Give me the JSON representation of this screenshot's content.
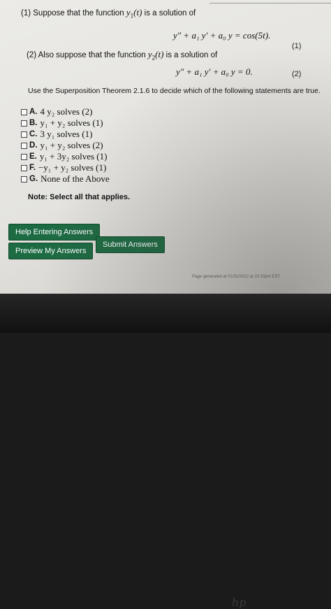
{
  "problem": {
    "part1_prefix": "(1) Suppose that the function ",
    "part1_func": "y",
    "part1_sub": "1",
    "part1_arg": "(t)",
    "part1_suffix": " is a solution of",
    "eq1": "y″ + a₁ y′ + a₀ y = cos(5t).",
    "eq1_num": "(1)",
    "part2_prefix": "(2) Also suppose that the function ",
    "part2_func": "y",
    "part2_sub": "2",
    "part2_arg": "(t)",
    "part2_suffix": " is a solution of",
    "eq2": "y″ + a₁ y′ + a₀ y = 0.",
    "eq2_num": "(2)",
    "instruction": "Use the Superposition Theorem 2.1.6 to decide which of the following statements are true."
  },
  "options": [
    {
      "letter": "A.",
      "text": "4 y₂  solves (2)",
      "checked": false
    },
    {
      "letter": "B.",
      "text": "y₁ + y₂  solves (1)",
      "checked": false
    },
    {
      "letter": "C.",
      "text": "3 y₁  solves (1)",
      "checked": false
    },
    {
      "letter": "D.",
      "text": "y₁ + y₂  solves (2)",
      "checked": false
    },
    {
      "letter": "E.",
      "text": "y₁ + 3y₂  solves (1)",
      "checked": false
    },
    {
      "letter": "F.",
      "text": "−y₁ + y₂  solves (1)",
      "checked": false
    },
    {
      "letter": "G.",
      "text": "None of the Above",
      "checked": false
    }
  ],
  "note": "Note: Select all that applies.",
  "buttons": {
    "help": "Help Entering Answers",
    "preview": "Preview My Answers",
    "submit": "Submit Answers"
  },
  "footer": "Page generated at 01/31/2022 at 10:15pm EST",
  "device_logo": "hp",
  "colors": {
    "button_green": "#1d6b43",
    "page_background": "#ecebe7",
    "bezel": "#1b1b1b"
  }
}
